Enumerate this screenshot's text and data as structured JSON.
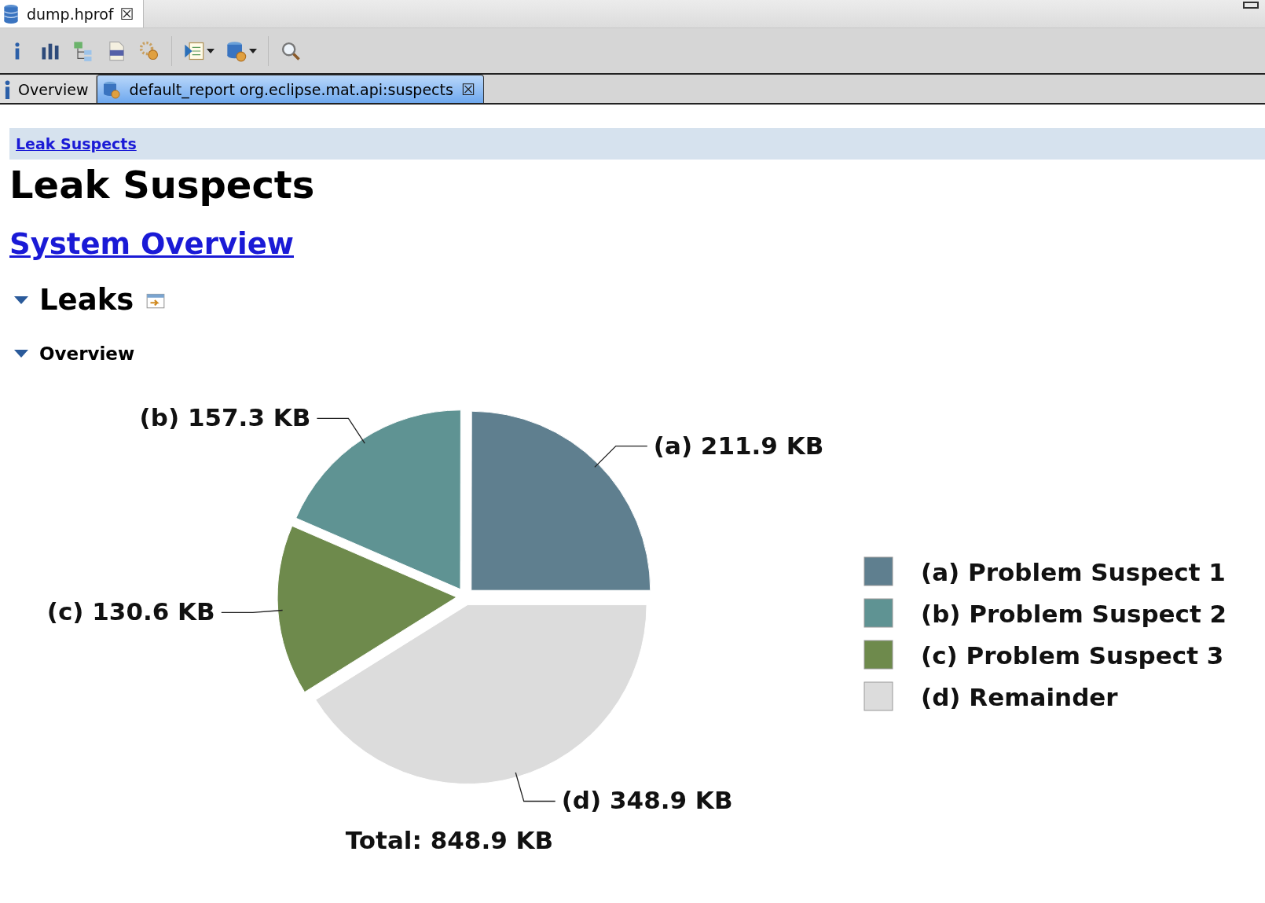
{
  "editor_tab": {
    "title": "dump.hprof",
    "close": "☒"
  },
  "report_tabs": [
    {
      "label": "Overview",
      "selected": false
    },
    {
      "label": "default_report  org.eclipse.mat.api:suspects",
      "selected": true,
      "close": "☒"
    }
  ],
  "breadcrumb": "Leak Suspects",
  "title": "Leak Suspects",
  "system_overview_link": "System Overview",
  "leaks": {
    "title": "Leaks",
    "expanded": true,
    "overview": {
      "title": "Overview",
      "expanded": true,
      "chart_data": {
        "type": "pie",
        "categories": [
          "(a)  Problem Suspect 1",
          "(b)  Problem Suspect 2",
          "(c)  Problem Suspect 3",
          "(d)  Remainder"
        ],
        "colors": [
          "#5f7f8f",
          "#5f9393",
          "#6e8a4c",
          "#dcdcdc"
        ],
        "series": [
          {
            "values": [
              24.97,
              18.53,
              15.39,
              41.11
            ]
          }
        ],
        "value_labels": [
          "(a)  211.9 KB",
          "(b)  157.3 KB",
          "(c)  130.6 KB",
          "(d)  348.9 KB"
        ],
        "annotations": [
          "Total: 848.9 KB"
        ],
        "legend": "right"
      }
    }
  }
}
